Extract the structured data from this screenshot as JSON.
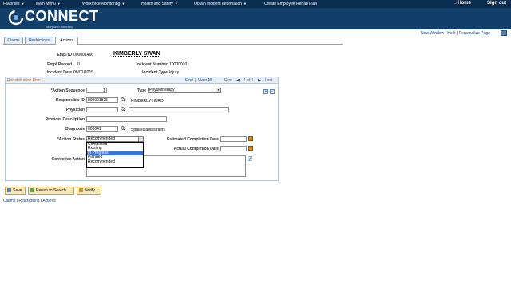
{
  "topnav": {
    "items": [
      "Favorites",
      "Main Menu",
      "Workforce Monitoring",
      "Health and Safety",
      "Obtain Incident Information",
      "Create Employee Rehab Plan"
    ],
    "home": "Home",
    "signout": "Sign out"
  },
  "brand": {
    "name": "CONNECT",
    "sub": "Maryland Judiciary"
  },
  "toplinks": {
    "new_window": "New Window",
    "help": "Help",
    "personalize": "Personalize Page",
    "sep": "|"
  },
  "tabs": [
    "Claims",
    "Restrictions",
    "Actions"
  ],
  "header": {
    "empl_id_label": "Empl ID",
    "empl_id": "000001466",
    "name": "KIMBERLY SWAN",
    "empl_record_label": "Empl Record",
    "empl_record": "0",
    "incident_number_label": "Incident Number",
    "incident_number": "70000010",
    "incident_date_label": "Incident Date",
    "incident_date": "08/01/2015",
    "incident_type_label": "Incident Type",
    "incident_type": "Injury"
  },
  "plan": {
    "title": "Rehabilitation Plan",
    "find": "Find",
    "view_all": "View All",
    "nav_sep": "|",
    "first": "First",
    "range": "1 of 1",
    "last": "Last",
    "action_sequence_label": "*Action Sequence",
    "action_sequence": "1",
    "type_label": "Type",
    "type_value": "Physiotherapy",
    "responsible_id_label": "Responsible ID",
    "responsible_id": "000001825",
    "responsible_name": "KIMBERLY HURD",
    "physician_label": "Physician",
    "physician": "",
    "provider_desc_label": "Provider Description",
    "provider_desc": "",
    "diagnosis_label": "Diagnosis",
    "diagnosis": "000041",
    "diagnosis_desc": "Sprains and strains",
    "action_status_label": "*Action Status",
    "action_status": "Recommended",
    "status_options": [
      "Completed",
      "Existing",
      "In Progress",
      "Planned",
      "Recommended"
    ],
    "highlighted_option": "In Progress",
    "est_completion_label": "Estimated Completion Date",
    "est_completion": "",
    "act_completion_label": "Actual Completion Date",
    "act_completion": "",
    "corrective_action_label": "Corrective Action"
  },
  "buttons": {
    "save": "Save",
    "return": "Return to Search",
    "notify": "Notify"
  },
  "footer_links": [
    "Claims",
    "Restrictions",
    "Actions"
  ]
}
